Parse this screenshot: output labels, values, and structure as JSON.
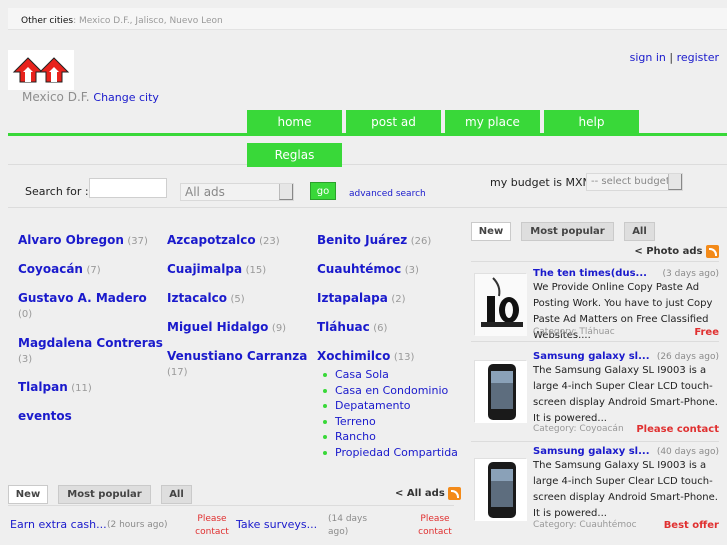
{
  "topbar": {
    "label": "Other cities",
    "cities": ": Mexico D.F., Jalisco, Nuevo Leon"
  },
  "header": {
    "city": "Mexico D.F.",
    "change_city": "Change city",
    "sign_in": "sign in",
    "separator": "|",
    "register": "register"
  },
  "nav": {
    "tabs": [
      "home",
      "post ad",
      "my place",
      "help"
    ],
    "rules_tab": "Reglas"
  },
  "search": {
    "label": "Search for :",
    "query_value": "",
    "category_selected": "All ads",
    "go": "go",
    "advanced": "advanced search",
    "budget_label": "my budget is MXN",
    "budget_selected": "-- select budget --"
  },
  "municipalities": {
    "col1": [
      {
        "name": "Alvaro Obregon",
        "count": "(37)"
      },
      {
        "name": "Coyoacán",
        "count": "(7)"
      },
      {
        "name": "Gustavo A. Madero",
        "count": "(0)"
      },
      {
        "name": "Magdalena Contreras",
        "count": "(3)"
      },
      {
        "name": "Tlalpan",
        "count": "(11)"
      },
      {
        "name": "eventos",
        "count": ""
      }
    ],
    "col2": [
      {
        "name": "Azcapotzalco",
        "count": "(23)"
      },
      {
        "name": "Cuajimalpa",
        "count": "(15)"
      },
      {
        "name": "Iztacalco",
        "count": "(5)"
      },
      {
        "name": "Miguel Hidalgo",
        "count": "(9)"
      },
      {
        "name": "Venustiano Carranza",
        "count": "(17)"
      }
    ],
    "col3": [
      {
        "name": "Benito Juárez",
        "count": "(26)"
      },
      {
        "name": "Cuauhtémoc",
        "count": "(3)"
      },
      {
        "name": "Iztapalapa",
        "count": "(2)"
      },
      {
        "name": "Tláhuac",
        "count": "(6)"
      },
      {
        "name": "Xochimilco",
        "count": "(13)"
      }
    ],
    "xochimilco_subs": [
      "Casa Sola",
      "Casa en Condominio",
      "Depatamento",
      "Terreno",
      "Rancho",
      "Propiedad Compartida"
    ]
  },
  "photo_ads": {
    "tabs": [
      "New",
      "Most popular",
      "All"
    ],
    "more": "< Photo ads",
    "items": [
      {
        "title": "The ten times(dus...",
        "date": "(3 days ago)",
        "desc": "We Provide Online Copy Paste Ad Posting Work. You have to just Copy Paste Ad Matters on Free Classified Websites....",
        "category": "Category: Tláhuac",
        "price": "Free",
        "thumb": "number-10-image"
      },
      {
        "title": "Samsung galaxy sl...",
        "date": "(26 days ago)",
        "desc": "The Samsung Galaxy SL I9003 is a large 4-inch Super Clear LCD touch-screen display Android Smart-Phone. It is powered...",
        "category": "Category: Coyoacán",
        "price": "Please contact",
        "thumb": "phone-image"
      },
      {
        "title": "Samsung galaxy sl...",
        "date": "(40 days ago)",
        "desc": "The Samsung Galaxy SL I9003 is a large 4-inch Super Clear LCD touch-screen display Android Smart-Phone. It is powered...",
        "category": "Category: Cuauhtémoc",
        "price": "Best offer",
        "thumb": "phone-image"
      }
    ]
  },
  "all_ads": {
    "tabs": [
      "New",
      "Most popular",
      "All"
    ],
    "more": "< All ads",
    "items": [
      {
        "title": "Earn extra cash...",
        "date": "(2 hours ago)",
        "price_line1": "Please",
        "price_line2": "contact"
      },
      {
        "title": "Take surveys...",
        "date_line1": "(14 days",
        "date_line2": "ago)",
        "price_line1": "Please",
        "price_line2": "contact"
      }
    ]
  },
  "colors": {
    "accent_green": "#39d839",
    "link_blue": "#1a1acc",
    "price_red": "#e03030",
    "logo_red": "#e8221c",
    "rss_orange": "#f38a19"
  }
}
